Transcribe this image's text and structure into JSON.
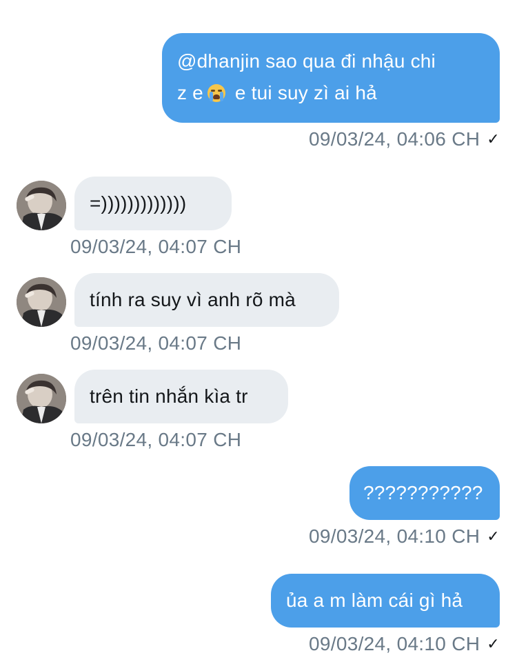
{
  "messages": [
    {
      "direction": "outgoing",
      "line1": "@dhanjin sao qua đi nhậu chi",
      "line2_pre": "z e",
      "line2_emoji": "crying-face-emoji",
      "line2_post": " e tui suy zì ai hả",
      "timestamp": "09/03/24, 04:06 CH",
      "status_icon": "checkmark-icon",
      "status_glyph": "✓"
    },
    {
      "direction": "incoming",
      "text": "=)))))))))))))",
      "timestamp": "09/03/24, 04:07 CH"
    },
    {
      "direction": "incoming",
      "text": "tính ra suy vì anh rõ mà",
      "timestamp": "09/03/24, 04:07 CH"
    },
    {
      "direction": "incoming",
      "text": "trên tin nhắn kìa tr",
      "timestamp": "09/03/24, 04:07 CH"
    },
    {
      "direction": "outgoing",
      "text": "???????????",
      "timestamp": "09/03/24, 04:10 CH",
      "status_glyph": "✓"
    },
    {
      "direction": "outgoing",
      "text": "ủa a m làm cái gì hả",
      "timestamp": "09/03/24, 04:10 CH",
      "status_glyph": "✓"
    }
  ],
  "colors": {
    "outgoing_bubble": "#4c9fe9",
    "incoming_bubble": "#e9edf1",
    "timestamp": "#697987"
  }
}
